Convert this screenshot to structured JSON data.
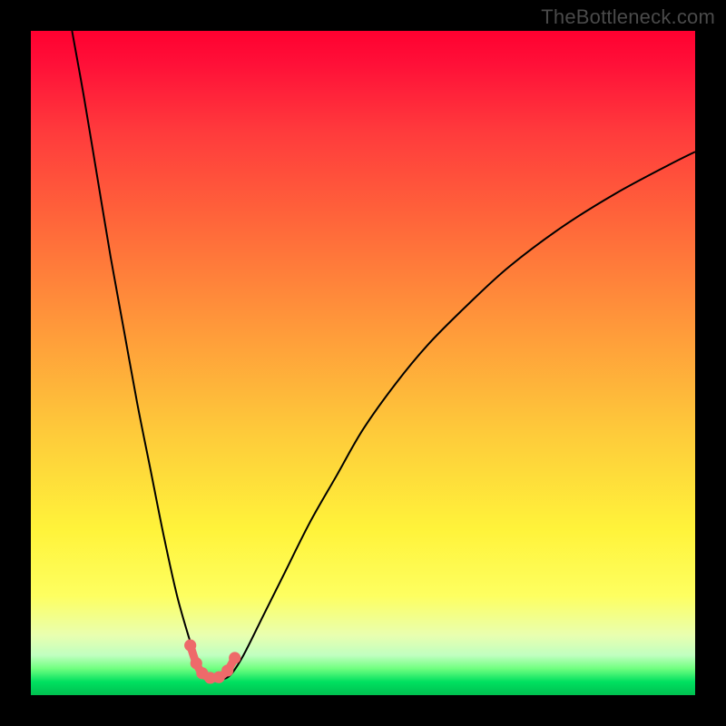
{
  "watermark": "TheBottleneck.com",
  "chart_data": {
    "type": "line",
    "title": "",
    "xlabel": "",
    "ylabel": "",
    "xlim": [
      0,
      100
    ],
    "ylim": [
      0,
      100
    ],
    "grid": false,
    "legend": false,
    "background_gradient": {
      "top": "#ff0030",
      "middle": "#fff33a",
      "bottom": "#00c050"
    },
    "series": [
      {
        "name": "bottleneck-curve",
        "color": "#000000",
        "x": [
          6.2,
          8,
          10,
          12,
          14,
          16,
          18,
          20,
          22,
          24,
          25,
          26,
          27,
          28.5,
          30,
          32,
          35,
          38,
          42,
          46,
          50,
          55,
          60,
          66,
          72,
          80,
          88,
          96,
          100
        ],
        "y": [
          100,
          90,
          78,
          66,
          55,
          44,
          34,
          24,
          15,
          8,
          5,
          3.2,
          2.6,
          2.4,
          3,
          6,
          12,
          18,
          26,
          33,
          40,
          47,
          53,
          59,
          64.5,
          70.5,
          75.5,
          79.8,
          81.8
        ]
      }
    ],
    "markers": {
      "name": "optimal-range",
      "color": "#ee6a6a",
      "shape": "circle",
      "radius_pct": 0.9,
      "x": [
        24.0,
        24.9,
        25.8,
        27.0,
        28.3,
        29.6,
        30.7
      ],
      "y": [
        7.5,
        4.8,
        3.3,
        2.6,
        2.7,
        3.7,
        5.6
      ]
    }
  }
}
